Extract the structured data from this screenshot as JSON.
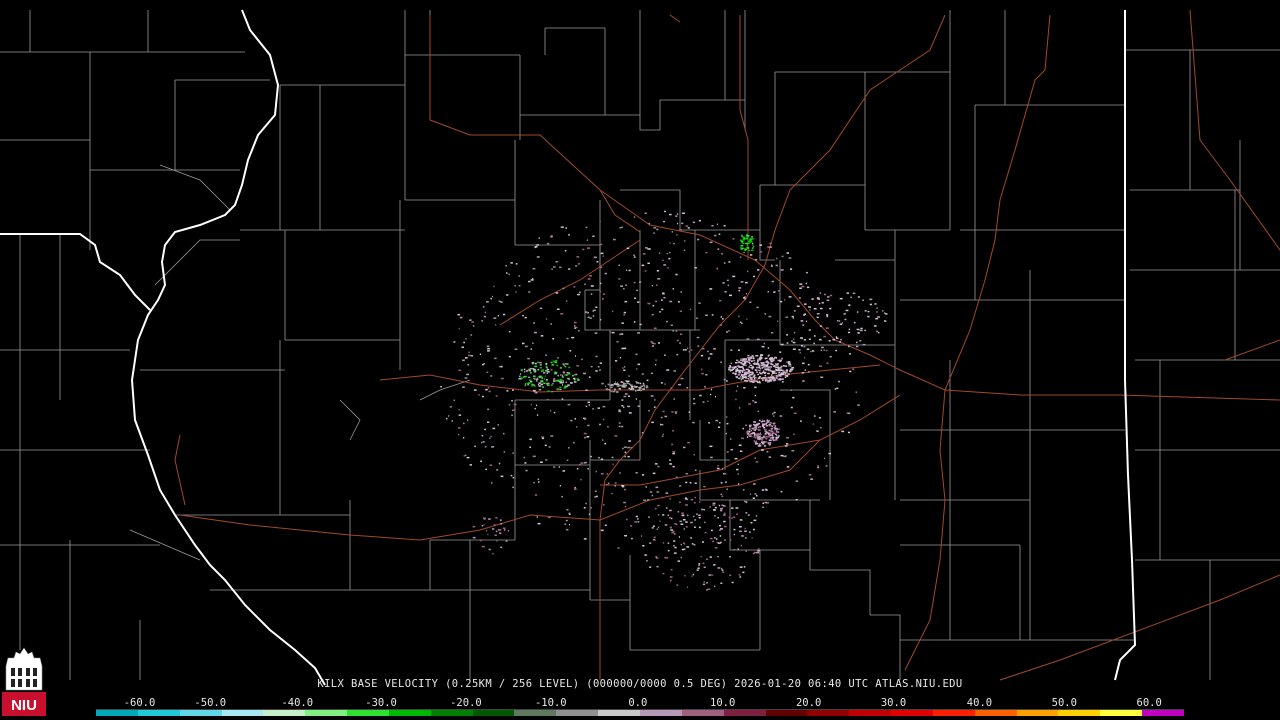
{
  "product": {
    "title": "KILX BASE VELOCITY (0.25KM / 256 LEVEL) (000000/0000 0.5 DEG) 2026-01-20 06:40 UTC  ATLAS.NIU.EDU"
  },
  "colorbar": {
    "labels": [
      "-60.0",
      "-50.0",
      "-40.0",
      "-30.0",
      "-20.0",
      "-10.0",
      "0.0",
      "10.0",
      "20.0",
      "30.0",
      "40.0",
      "50.0",
      "60.0"
    ],
    "colors": [
      "#00a8b8",
      "#20c8d8",
      "#60d8e8",
      "#a8e8f0",
      "#c8f0c8",
      "#80f080",
      "#30e030",
      "#00b800",
      "#008000",
      "#005800",
      "#607860",
      "#909090",
      "#c8c8c8",
      "#b898b8",
      "#a06080",
      "#802040",
      "#600000",
      "#900000",
      "#c00000",
      "#e00000",
      "#ff2000",
      "#ff6000",
      "#ffa000",
      "#ffd000",
      "#ffff40",
      "#c000c0"
    ]
  },
  "logo": {
    "text": "NIU"
  },
  "colors": {
    "county_lines": "#9a9a9a",
    "state_lines": "#ffffff",
    "highways": "#a04a28"
  }
}
